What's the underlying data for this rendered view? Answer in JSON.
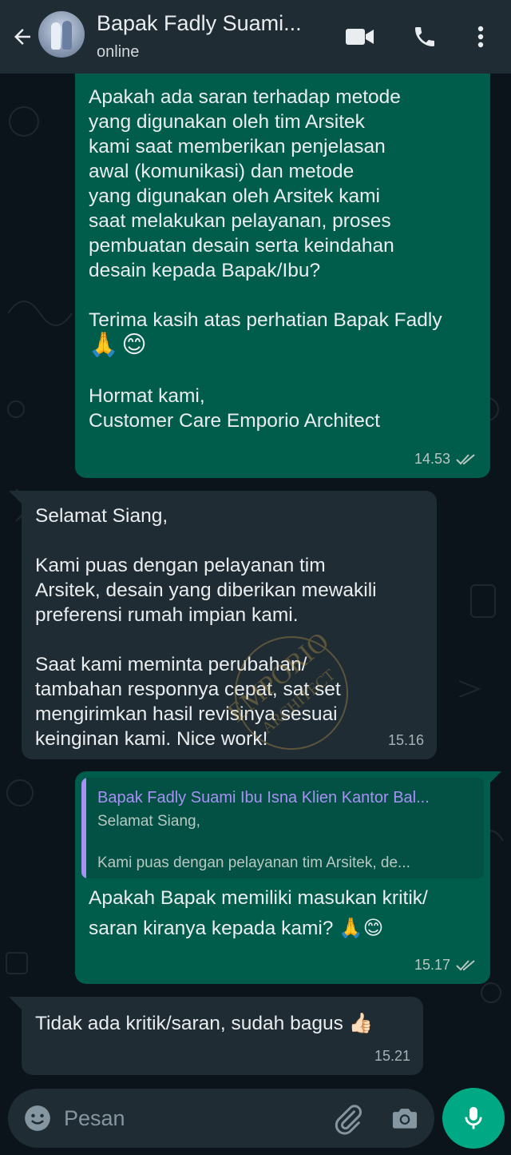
{
  "header": {
    "contact_name": "Bapak Fadly Suami...",
    "status": "online"
  },
  "messages": [
    {
      "direction": "outgoing",
      "text": "Apakah ada saran terhadap metode\nyang digunakan oleh tim Arsitek\nkami saat memberikan penjelasan\nawal (komunikasi) dan metode\nyang digunakan oleh Arsitek kami\nsaat melakukan pelayanan, proses\npembuatan desain serta keindahan\ndesain kepada Bapak/Ibu?\n\nTerima kasih atas perhatian Bapak Fadly",
      "emoji": "🙏😊",
      "signature": "Hormat kami,\nCustomer Care Emporio Architect",
      "time": "14.53"
    },
    {
      "direction": "incoming",
      "text": "Selamat Siang,\n\nKami puas dengan pelayanan tim\nArsitek, desain yang diberikan mewakili\npreferensi rumah impian kami.\n\nSaat kami meminta perubahan/\ntambahan responnya cepat, sat set\nmengirimkan hasil revisinya sesuai\nkeinginan kami. Nice work!",
      "time": "15.16"
    },
    {
      "direction": "outgoing",
      "quote": {
        "name": "Bapak Fadly Suami Ibu Isna Klien Kantor Bal...",
        "text": "Selamat Siang,\n\nKami puas dengan pelayanan tim Arsitek, de..."
      },
      "text": "Apakah Bapak memiliki masukan kritik/\nsaran kiranya kepada kami? 🙏😊",
      "time": "15.17"
    },
    {
      "direction": "incoming",
      "text": "Tidak ada kritik/saran,  sudah bagus 👍🏻",
      "time": "15.21"
    }
  ],
  "watermark": {
    "line1": "EMPORIO",
    "line2": "ARCHITECT"
  },
  "composer": {
    "placeholder": "Pesan"
  },
  "colors": {
    "outgoing_bubble": "#005c4b",
    "incoming_bubble": "#202c33",
    "accent": "#00a884",
    "quote_name": "#a791f5",
    "read_ticks": "#8ec1ff"
  }
}
